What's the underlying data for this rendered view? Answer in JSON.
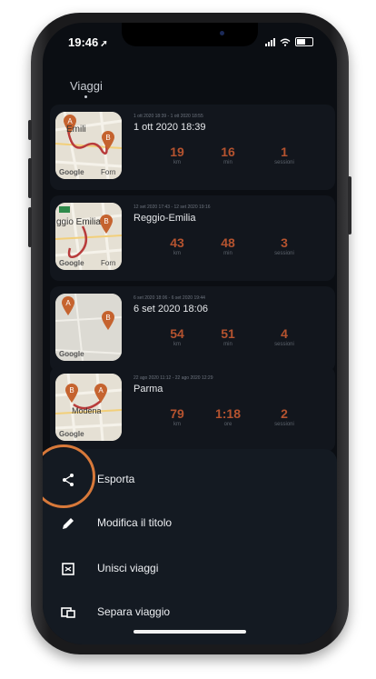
{
  "status_bar": {
    "time": "19:46",
    "location_icon": "location-arrow-icon"
  },
  "page": {
    "title": "Viaggi"
  },
  "trips": [
    {
      "range": "1 ott 2020 18:39 - 1 ott 2020 18:55",
      "title": "1 ott 2020 18:39",
      "map_text": "Emili",
      "map_text2": "Forn",
      "stats": [
        {
          "value": "19",
          "unit": "km"
        },
        {
          "value": "16",
          "unit": "min"
        },
        {
          "value": "1",
          "unit": "sessioni"
        }
      ]
    },
    {
      "range": "12 set 2020 17:43 - 12 set 2020 19:16",
      "title": "Reggio-Emilia",
      "map_text": "ggio Emilia",
      "map_text2": "Forn",
      "stats": [
        {
          "value": "43",
          "unit": "km"
        },
        {
          "value": "48",
          "unit": "min"
        },
        {
          "value": "3",
          "unit": "sessioni"
        }
      ]
    },
    {
      "range": "6 set 2020 18:06 - 6 set 2020 19:44",
      "title": "6 set 2020 18:06",
      "map_text": "",
      "map_text2": "",
      "stats": [
        {
          "value": "54",
          "unit": "km"
        },
        {
          "value": "51",
          "unit": "min"
        },
        {
          "value": "4",
          "unit": "sessioni"
        }
      ]
    },
    {
      "range": "22 ago 2020 11:12 - 22 ago 2020 12:29",
      "title": "Parma",
      "map_text": "Modena",
      "map_text2": "",
      "stats": [
        {
          "value": "79",
          "unit": "km"
        },
        {
          "value": "1:18",
          "unit": "ore"
        },
        {
          "value": "2",
          "unit": "sessioni"
        }
      ]
    }
  ],
  "map_attribution": "Google",
  "map_marker_a": "A",
  "map_marker_b": "B",
  "sheet": {
    "items": [
      {
        "label": "Esporta",
        "icon": "share-icon"
      },
      {
        "label": "Modifica il titolo",
        "icon": "pencil-icon"
      },
      {
        "label": "Unisci viaggi",
        "icon": "merge-icon"
      },
      {
        "label": "Separa viaggio",
        "icon": "split-icon"
      }
    ]
  },
  "colors": {
    "background": "#0b0e13",
    "card": "#12161d",
    "stat_value": "#b5532f",
    "marker": "#c5632f",
    "highlight_ring": "#d8793a",
    "sheet": "#141a22"
  }
}
